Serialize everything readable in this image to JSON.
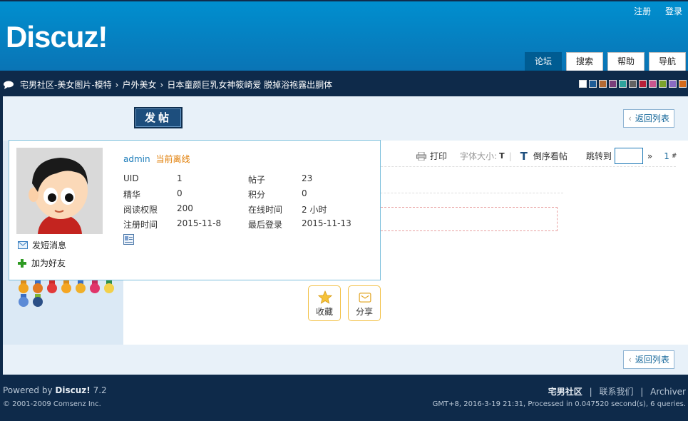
{
  "header": {
    "logo": "Discuz!",
    "links": {
      "register": "注册",
      "login": "登录"
    },
    "nav": [
      {
        "label": "论坛",
        "active": true
      },
      {
        "label": "搜索",
        "active": false
      },
      {
        "label": "帮助",
        "active": false
      },
      {
        "label": "导航",
        "active": false
      }
    ]
  },
  "breadcrumb": {
    "items": [
      "宅男社区-美女图片-模特",
      "户外美女",
      "日本童颜巨乳女神筱崎爱 脱掉浴袍露出胴体"
    ],
    "separator": "›"
  },
  "style_swatches": [
    "#ffffff",
    "#1e5c96",
    "#b46a34",
    "#7b3f7b",
    "#2ea39d",
    "#636363",
    "#b8203a",
    "#c9578f",
    "#7ca32c",
    "#8a6bc1",
    "#d46a1a"
  ],
  "toolbar": {
    "post_button": "发帖",
    "back_to_list": "返回列表",
    "print": "打印",
    "font_size": "字体大小:",
    "font_size_t": "T",
    "big_t": "T",
    "reverse": "倒序看帖",
    "jump_to": "跳转到",
    "jump_arrow": "»",
    "page_num": "1",
    "hash": "#"
  },
  "actions": {
    "favorite": "收藏",
    "share": "分享"
  },
  "user_card": {
    "username": "admin",
    "status": "当前离线",
    "stats": [
      {
        "label": "UID",
        "value": "1"
      },
      {
        "label": "帖子",
        "value": "23"
      },
      {
        "label": "精华",
        "value": "0"
      },
      {
        "label": "积分",
        "value": "0"
      },
      {
        "label": "阅读权限",
        "value": "200"
      },
      {
        "label": "在线时间",
        "value": "2 小时"
      },
      {
        "label": "注册时间",
        "value": "2015-11-8"
      },
      {
        "label": "最后登录",
        "value": "2015-11-13"
      }
    ],
    "send_message": "发短消息",
    "add_friend": "加为好友"
  },
  "footer": {
    "powered_prefix": "Powered by",
    "product": "Discuz!",
    "version": "7.2",
    "copyright": "© 2001-2009 Comsenz Inc.",
    "site_name": "宅男社区",
    "contact": "联系我们",
    "archiver": "Archiver",
    "gmt": "GMT+8, 2016-3-19 21:31, Processed in 0.047520 second(s), 6 queries."
  }
}
